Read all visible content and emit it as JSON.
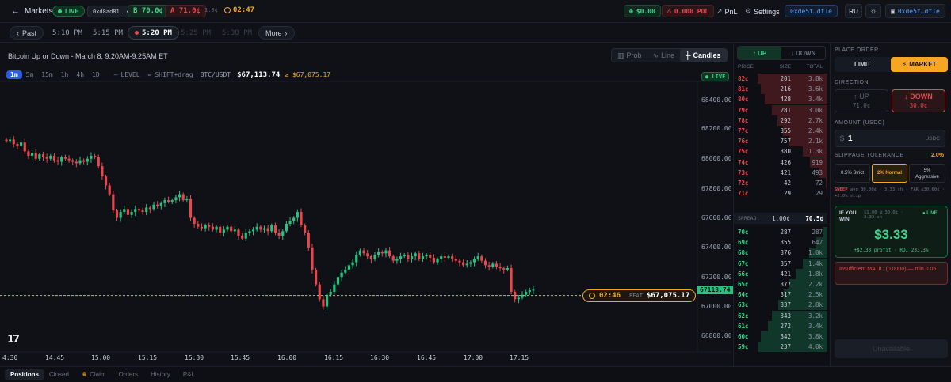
{
  "header": {
    "back_label": "Markets",
    "live_label": "LIVE",
    "market_id": "0xd8ad81…",
    "bid_label": "B 70.0¢",
    "ask_label": "A 71.0¢",
    "tick_size": "1.0¢",
    "timer": "02:47",
    "usd_balance": "$0.00",
    "pol_balance": "0.000 POL",
    "pnl_label": "PnL",
    "settings_label": "Settings",
    "address_short": "0xde5f…df1e",
    "lang": "RU",
    "wallet_address": "0xde5f…df1e"
  },
  "timebar": {
    "past_label": "Past",
    "times": [
      "5:10 PM",
      "5:15 PM",
      "5:20 PM",
      "5:25 PM",
      "5:30 PM"
    ],
    "active_time": "5:20 PM",
    "more_label": "More"
  },
  "chart": {
    "title": "Bitcoin Up or Down - March 8, 9:20AM-9:25AM ET",
    "modes": [
      "Prob",
      "Line",
      "Candles"
    ],
    "active_mode": "Candles",
    "intervals": [
      "1m",
      "5m",
      "15m",
      "1h",
      "4h",
      "1D"
    ],
    "active_interval": "1m",
    "level_label": "LEVEL",
    "shift_label": "SHIFT+drag",
    "pair": "BTC/USDT",
    "price": "$67,113.74",
    "beat_price_small": "≥ $67,075.17",
    "live_label": "● LIVE",
    "current_price_tag": "67113.74",
    "countdown": "02:46",
    "beat_label": "BEAT",
    "beat_price": "$67,075.17",
    "y_ticks": [
      "68400.00",
      "68200.00",
      "68000.00",
      "67800.00",
      "67600.00",
      "67400.00",
      "67200.00",
      "67000.00",
      "66800.00"
    ],
    "x_ticks": [
      "4:30",
      "14:45",
      "15:00",
      "15:15",
      "15:30",
      "15:45",
      "16:00",
      "16:15",
      "16:30",
      "16:45",
      "17:00",
      "17:15"
    ],
    "logo_text": "17"
  },
  "chart_data": {
    "type": "candlestick",
    "x_start": "14:30",
    "interval": "1m",
    "ylim": [
      66750,
      68500
    ],
    "beat_level": 67075.17,
    "last_price": 67113.74,
    "closes": [
      68120,
      68130,
      68100,
      68090,
      68110,
      68050,
      68020,
      68040,
      68000,
      68030,
      68010,
      68000,
      68020,
      67990,
      67980,
      68010,
      68000,
      67990,
      67980,
      67970,
      67990,
      67980,
      68000,
      68020,
      68010,
      67950,
      67880,
      67820,
      67760,
      67650,
      67600,
      67640,
      67660,
      67620,
      67640,
      67660,
      67650,
      67640,
      67670,
      67660,
      67690,
      67680,
      67700,
      67720,
      67710,
      67720,
      67740,
      67760,
      67720,
      67730,
      67600,
      67560,
      67540,
      67530,
      67550,
      67540,
      67520,
      67540,
      67500,
      67520,
      67540,
      67510,
      67520,
      67480,
      67460,
      67500,
      67510,
      67520,
      67540,
      67520,
      67530,
      67510,
      67550,
      67500,
      67480,
      67510,
      67560,
      67580,
      67600,
      67640,
      67550,
      67500,
      67400,
      67250,
      67150,
      67050,
      67000,
      67080,
      67100,
      67150,
      67200,
      67230,
      67250,
      67280,
      67300,
      67350,
      67380,
      67360,
      67340,
      67320,
      67350,
      67370,
      67360,
      67380,
      67340,
      67310,
      67320,
      67340,
      67350,
      67320,
      67340,
      67360,
      67320,
      67340,
      67350,
      67330,
      67300,
      67320,
      67340,
      67330,
      67340,
      67320,
      67310,
      67300,
      67280,
      67290,
      67300,
      67320,
      67340,
      67310,
      67280,
      67270,
      67290,
      67270,
      67260,
      67250,
      67260,
      67100,
      67050,
      67060,
      67080,
      67100,
      67110,
      67113.74
    ]
  },
  "orderbook": {
    "tabs": [
      "↑ UP",
      "↓ DOWN"
    ],
    "active_tab": "↑ UP",
    "headers": [
      "PRICE",
      "SIZE",
      "TOTAL"
    ],
    "asks": [
      [
        "82¢",
        "201",
        "3.8k"
      ],
      [
        "81¢",
        "216",
        "3.6k"
      ],
      [
        "80¢",
        "428",
        "3.4k"
      ],
      [
        "79¢",
        "281",
        "3.0k"
      ],
      [
        "78¢",
        "292",
        "2.7k"
      ],
      [
        "77¢",
        "355",
        "2.4k"
      ],
      [
        "76¢",
        "757",
        "2.1k"
      ],
      [
        "75¢",
        "380",
        "1.3k"
      ],
      [
        "74¢",
        "426",
        "919"
      ],
      [
        "73¢",
        "421",
        "493"
      ],
      [
        "72¢",
        "42",
        "72"
      ],
      [
        "71¢",
        "29",
        "29"
      ]
    ],
    "ask_depth": [
      1.0,
      0.95,
      0.9,
      0.8,
      0.72,
      0.64,
      0.56,
      0.35,
      0.25,
      0.13,
      0.02,
      0.01
    ],
    "spread_label": "SPREAD",
    "spread_value": "1.00¢",
    "mid_value": "70.5¢",
    "bids": [
      [
        "70¢",
        "287",
        "287"
      ],
      [
        "69¢",
        "355",
        "642"
      ],
      [
        "68¢",
        "376",
        "1.0k"
      ],
      [
        "67¢",
        "357",
        "1.4k"
      ],
      [
        "66¢",
        "421",
        "1.8k"
      ],
      [
        "65¢",
        "377",
        "2.2k"
      ],
      [
        "64¢",
        "317",
        "2.5k"
      ],
      [
        "63¢",
        "337",
        "2.8k"
      ],
      [
        "62¢",
        "343",
        "3.2k"
      ],
      [
        "61¢",
        "272",
        "3.4k"
      ],
      [
        "60¢",
        "342",
        "3.8k"
      ],
      [
        "59¢",
        "237",
        "4.0k"
      ]
    ],
    "bid_depth": [
      0.07,
      0.16,
      0.26,
      0.35,
      0.45,
      0.55,
      0.63,
      0.7,
      0.8,
      0.85,
      0.95,
      1.0
    ]
  },
  "order": {
    "title": "PLACE ORDER",
    "limit_label": "LIMIT",
    "market_label": "MARKET",
    "direction_label": "DIRECTION",
    "up_label": "↑ UP",
    "up_price": "71.0¢",
    "down_label": "↓ DOWN",
    "down_price": "30.0¢",
    "amount_label": "AMOUNT (USDC)",
    "amount_prefix": "$",
    "amount_value": "1",
    "amount_unit": "USDC",
    "slippage_label": "SLIPPAGE TOLERANCE",
    "slippage_value": "2.0%",
    "slip_strict": "0.5% Strict",
    "slip_normal": "2% Normal",
    "slip_aggr_1": "5%",
    "slip_aggr_2": "Aggressive",
    "sweep_tag": "SWEEP",
    "sweep_text": "avg 30.00¢ · 3.33 sh · FAK ≤30.60¢ · +2.0% slip",
    "win_label_1": "IF YOU",
    "win_label_2": "WIN",
    "win_info": "$1.00 @ 30.0¢ · 3.33 sh",
    "win_live": "● LIVE",
    "win_amount": "$3.33",
    "win_profit": "+$2.33 profit · ROI 233.3%",
    "error_text": "Insufficient MATIC (0.0000) — min 0.05",
    "submit_label": "Unavailable"
  },
  "bottom_tabs": [
    "Positions",
    "Closed",
    "Claim",
    "Orders",
    "History",
    "P&L"
  ],
  "colors": {
    "up": "#26c281",
    "down": "#e5484d",
    "accent": "#f5a623",
    "bg": "#0d0f14"
  }
}
